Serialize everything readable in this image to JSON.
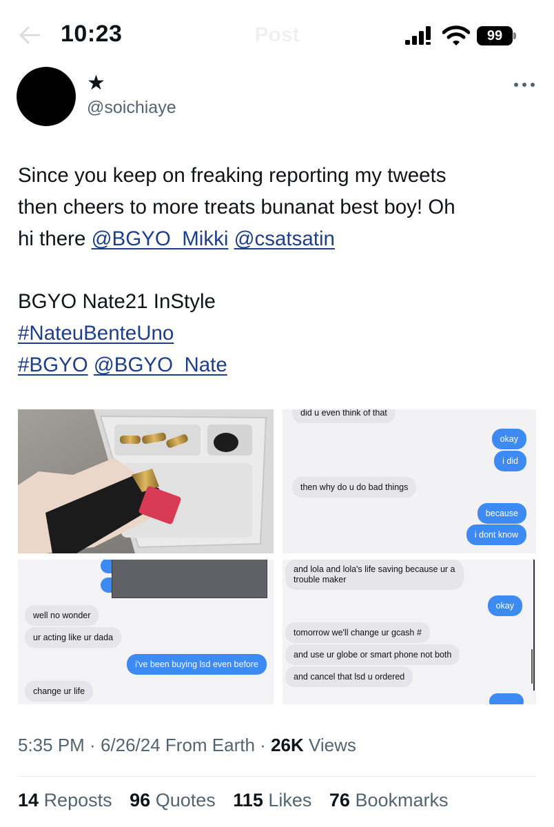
{
  "status_bar": {
    "time": "10:23",
    "battery": "99",
    "ghost_title": "Post"
  },
  "post": {
    "display_name": "★",
    "handle": "@soichiaye",
    "text": {
      "line1": "Since you keep on freaking reporting my tweets",
      "line2": "then cheers to more treats bunanat best boy! Oh",
      "line3_prefix": "hi there ",
      "mention_mikki": "@BGYO_Mikki",
      "mention_csatsatin": "@csatsatin",
      "line4": "BGYO Nate21 InStyle",
      "hashtag_nateu": "#NateuBenteUno",
      "hashtag_bgyo": "#BGYO",
      "mention_nate": "@BGYO_Nate"
    },
    "media": {
      "chat_top_right": {
        "messages": [
          {
            "side": "gray",
            "text": "did u even think of that"
          },
          {
            "side": "blue",
            "text": "okay"
          },
          {
            "side": "blue",
            "text": "i did"
          },
          {
            "side": "gray",
            "text": "then why do u do bad things"
          },
          {
            "side": "blue",
            "text": "because"
          },
          {
            "side": "blue",
            "text": "i dont know"
          }
        ]
      },
      "chat_bottom_left": {
        "messages": [
          {
            "side": "gray",
            "text": "well no wonder"
          },
          {
            "side": "gray",
            "text": "ur acting like ur dada"
          },
          {
            "side": "blue",
            "text": "i've been buying lsd even before"
          },
          {
            "side": "gray",
            "text": "change ur life"
          }
        ]
      },
      "chat_bottom_right": {
        "messages": [
          {
            "side": "gray",
            "text": "and lola and lola's life saving because ur a"
          },
          {
            "side": "gray",
            "text": "trouble maker"
          },
          {
            "side": "blue",
            "text": "okay"
          },
          {
            "side": "gray",
            "text": "tomorrow we'll change ur gcash #"
          },
          {
            "side": "gray",
            "text": "and use ur globe or smart phone not both"
          },
          {
            "side": "gray",
            "text": "and cancel that lsd u ordered"
          }
        ]
      }
    },
    "meta": {
      "time": "5:35 PM",
      "date": "6/26/24",
      "source": "From Earth",
      "views_count": "26K",
      "views_label": "Views"
    },
    "stats": {
      "reposts_count": "14",
      "reposts_label": "Reposts",
      "quotes_count": "96",
      "quotes_label": "Quotes",
      "likes_count": "115",
      "likes_label": "Likes",
      "bookmarks_count": "76",
      "bookmarks_label": "Bookmarks"
    }
  },
  "colors": {
    "link": "#1d3d8f",
    "secondary_text": "#536471",
    "imessage_blue": "#3d8bf2",
    "imessage_gray": "#e5e5ea"
  }
}
